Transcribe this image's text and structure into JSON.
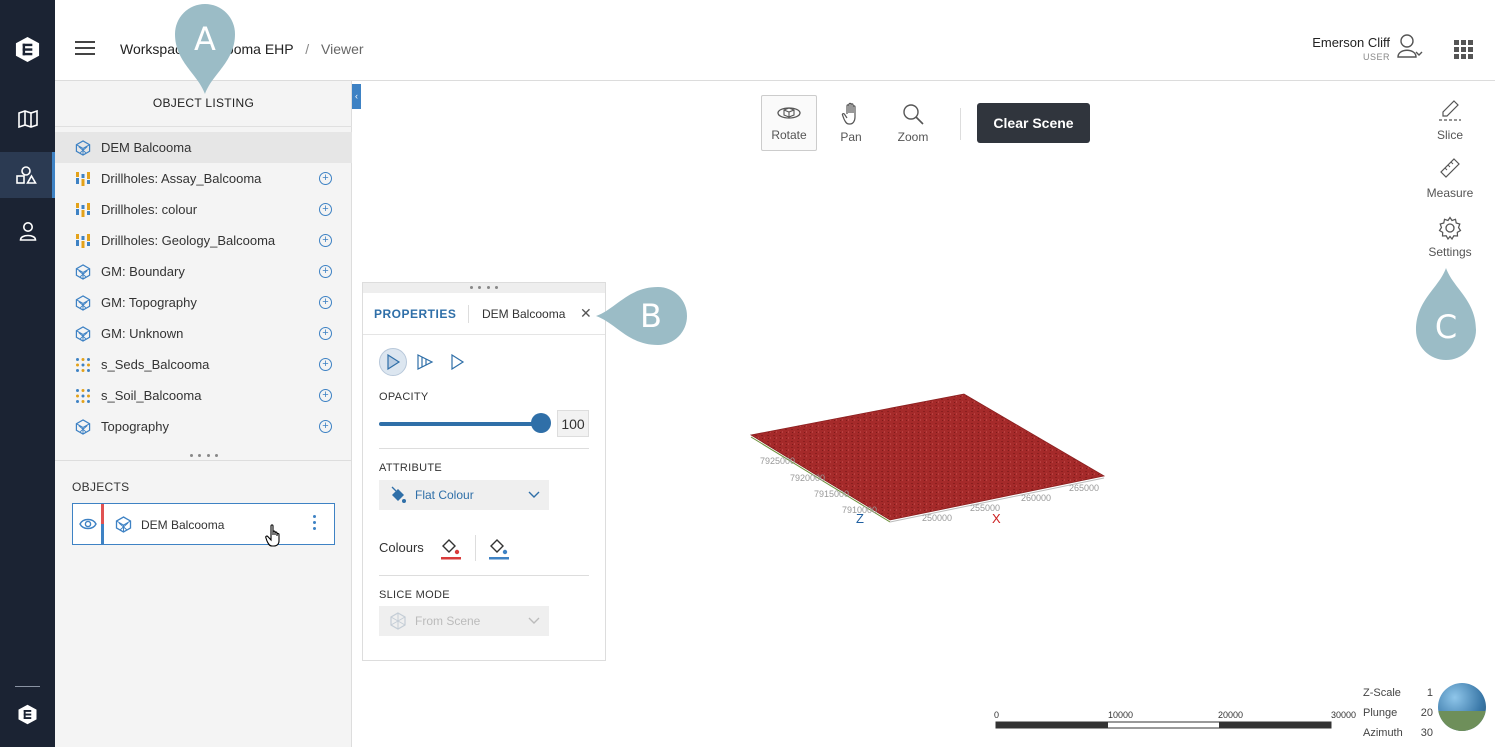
{
  "header": {
    "breadcrumb": [
      "Workspace",
      "Balcooma EHP",
      "Viewer"
    ],
    "breadcrumb_sep": "/",
    "user_name": "Emerson Cliff",
    "user_role": "USER"
  },
  "sidebar": {
    "items": [
      {
        "icon": "map-icon"
      },
      {
        "icon": "objects-icon",
        "active": true
      },
      {
        "icon": "user-icon"
      }
    ]
  },
  "object_listing": {
    "title": "OBJECT LISTING",
    "items": [
      {
        "label": "DEM Balcooma",
        "icon": "surface-icon",
        "selected": true
      },
      {
        "label": "Drillholes: Assay_Balcooma",
        "icon": "drillholes-icon"
      },
      {
        "label": "Drillholes: colour",
        "icon": "drillholes-icon"
      },
      {
        "label": "Drillholes: Geology_Balcooma",
        "icon": "drillholes-icon"
      },
      {
        "label": "GM: Boundary",
        "icon": "surface-icon"
      },
      {
        "label": "GM: Topography",
        "icon": "surface-icon"
      },
      {
        "label": "GM: Unknown",
        "icon": "surface-icon"
      },
      {
        "label": "s_Seds_Balcooma",
        "icon": "points-icon"
      },
      {
        "label": "s_Soil_Balcooma",
        "icon": "points-icon"
      },
      {
        "label": "Topography",
        "icon": "surface-icon"
      }
    ]
  },
  "objects": {
    "title": "OBJECTS",
    "item_label": "DEM Balcooma"
  },
  "toolbar": {
    "rotate": "Rotate",
    "pan": "Pan",
    "zoom": "Zoom",
    "clear_scene": "Clear Scene"
  },
  "right_tools": {
    "slice": "Slice",
    "measure": "Measure",
    "settings": "Settings"
  },
  "properties": {
    "tab_label": "PROPERTIES",
    "object_name": "DEM Balcooma",
    "opacity_label": "OPACITY",
    "opacity_value": "100",
    "opacity_fraction": 1.0,
    "attribute_label": "ATTRIBUTE",
    "attribute_value": "Flat Colour",
    "colours_label": "Colours",
    "slice_mode_label": "SLICE MODE",
    "slice_mode_value": "From Scene"
  },
  "callouts": {
    "a": "A",
    "b": "B",
    "c": "C"
  },
  "scene": {
    "axis_x_label": "X",
    "axis_z_label": "Z",
    "x_ticks": [
      "250000",
      "255000",
      "260000",
      "265000"
    ],
    "y_ticks": [
      "7925000",
      "7920000",
      "7915000",
      "7910000"
    ],
    "surface_color": "#a52a2a"
  },
  "scalebar": {
    "ticks": [
      "0",
      "10000",
      "20000",
      "30000"
    ]
  },
  "nav_info": {
    "z_scale_label": "Z-Scale",
    "z_scale_value": "1",
    "plunge_label": "Plunge",
    "plunge_value": "20",
    "azimuth_label": "Azimuth",
    "azimuth_value": "30"
  },
  "colors": {
    "rail": "#1b2333",
    "accent": "#2f6fa8",
    "callout": "#9bbcc6",
    "clear_button": "#30353d"
  }
}
